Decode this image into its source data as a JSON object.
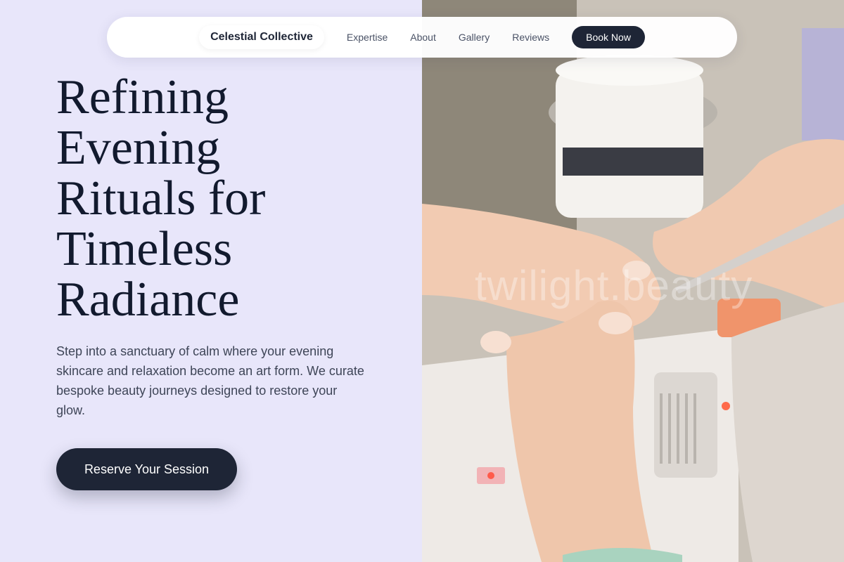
{
  "nav": {
    "brand": "Celestial Collective",
    "links": [
      "Expertise",
      "About",
      "Gallery",
      "Reviews"
    ],
    "cta": "Book Now"
  },
  "hero": {
    "headline_lines": [
      "Refining",
      "Evening",
      "Rituals for",
      "Timeless",
      "Radiance"
    ],
    "intro": "Step into a sanctuary of calm where your evening skincare and relaxation become an art form. We curate bespoke beauty journeys designed to restore your glow.",
    "cta": "Reserve Your Session",
    "photo_watermark": "twilight.beauty"
  },
  "colors": {
    "background": "#e8e6fa",
    "ink": "#121a2e",
    "button": "#1e2536"
  }
}
